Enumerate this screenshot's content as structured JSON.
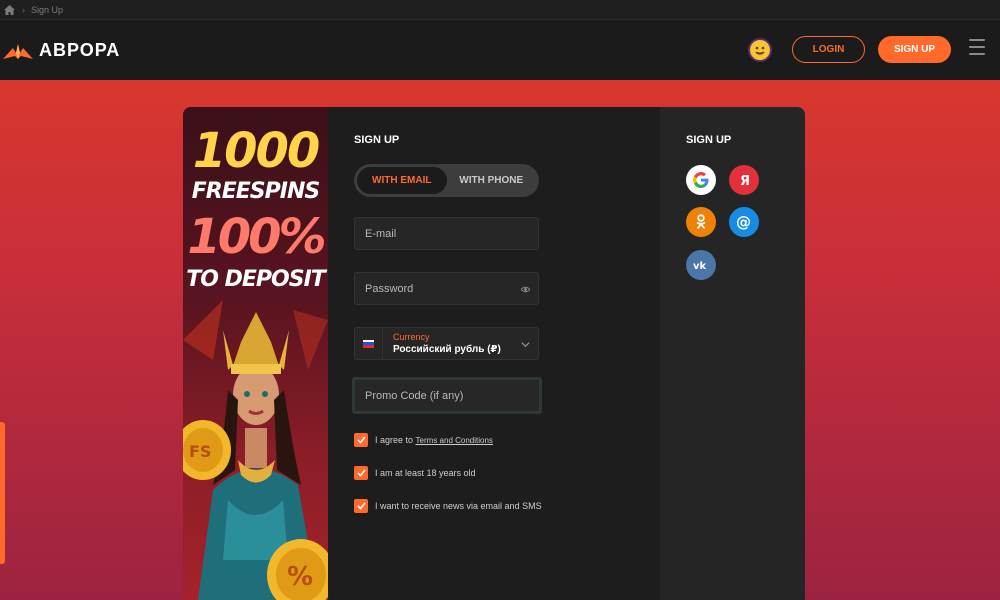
{
  "breadcrumb": {
    "current": "Sign Up"
  },
  "header": {
    "logo_text": "АВРОРА",
    "login_label": "LOGIN",
    "signup_label": "SIGN UP"
  },
  "promo": {
    "line1": "1000",
    "line2": "FREESPINS",
    "line3": "100%",
    "line4": "TO DEPOSIT"
  },
  "form": {
    "title": "SIGN UP",
    "tabs": [
      {
        "label": "WITH EMAIL",
        "active": true
      },
      {
        "label": "WITH PHONE",
        "active": false
      }
    ],
    "email_placeholder": "E-mail",
    "password_placeholder": "Password",
    "currency_label": "Currency",
    "currency_value": "Российский рубль (₽)",
    "promo_placeholder": "Promo Code (if any)",
    "checks": [
      {
        "text": "I agree to",
        "link": "Terms and Conditions",
        "checked": true
      },
      {
        "text": "I am at least 18 years old",
        "checked": true
      },
      {
        "text": "I want to receive news via email and SMS",
        "checked": true
      }
    ]
  },
  "social": {
    "title": "SIGN UP",
    "providers": [
      "google",
      "yandex",
      "odnoklassniki",
      "mail",
      "vk"
    ]
  },
  "colors": {
    "accent": "#ff6a2b",
    "header_bg": "#1b1b1b",
    "page_red": "#d9372d"
  }
}
